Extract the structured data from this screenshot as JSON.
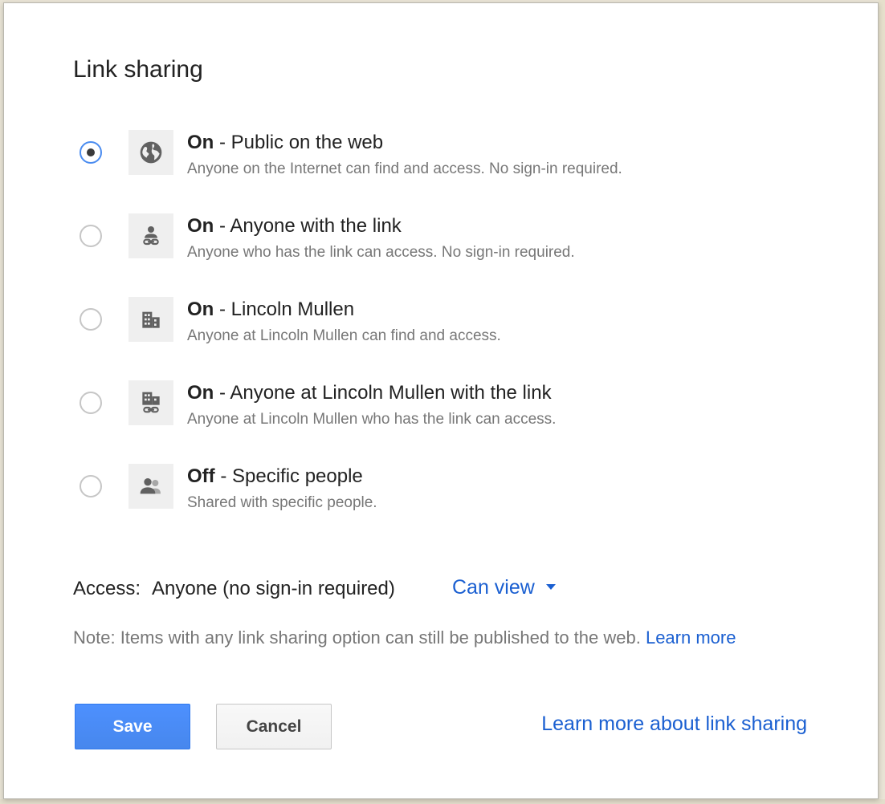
{
  "dialog": {
    "title": "Link sharing"
  },
  "options": [
    {
      "status": "On",
      "label": " - Public on the web",
      "description": "Anyone on the Internet can find and access. No sign-in required.",
      "icon": "globe-icon",
      "selected": true
    },
    {
      "status": "On",
      "label": " - Anyone with the link",
      "description": "Anyone who has the link can access. No sign-in required.",
      "icon": "person-link-icon",
      "selected": false
    },
    {
      "status": "On",
      "label": " - Lincoln Mullen",
      "description": "Anyone at Lincoln Mullen can find and access.",
      "icon": "building-icon",
      "selected": false
    },
    {
      "status": "On",
      "label": " - Anyone at Lincoln Mullen with the link",
      "description": "Anyone at Lincoln Mullen who has the link can access.",
      "icon": "building-link-icon",
      "selected": false
    },
    {
      "status": "Off",
      "label": " - Specific people",
      "description": "Shared with specific people.",
      "icon": "people-icon",
      "selected": false
    }
  ],
  "access": {
    "label": "Access:",
    "value": "Anyone (no sign-in required)",
    "permission": "Can view"
  },
  "note": {
    "text": "Note: Items with any link sharing option can still be published to the web. ",
    "link": "Learn more"
  },
  "buttons": {
    "save": "Save",
    "cancel": "Cancel"
  },
  "footer_link": "Learn more about link sharing",
  "colors": {
    "link": "#1a5fd1",
    "primary_button": "#4d90fe",
    "radio_selected_ring": "#4a8cf0"
  }
}
